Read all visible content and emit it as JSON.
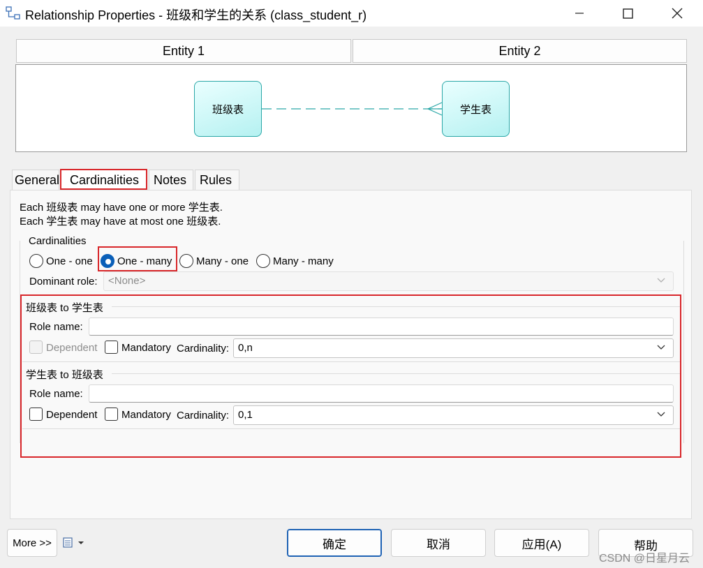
{
  "window": {
    "title": "Relationship Properties - 班级和学生的关系 (class_student_r)",
    "icons": {
      "app": "relationship-app-icon",
      "minimize": "minimize-icon",
      "maximize": "maximize-icon",
      "close": "close-icon"
    }
  },
  "entities": {
    "header1": "Entity 1",
    "header2": "Entity 2",
    "entity1_name": "班级表",
    "entity2_name": "学生表",
    "accent_color": "#2aa7a7"
  },
  "tabs": [
    {
      "label": "General"
    },
    {
      "label": "Cardinalities"
    },
    {
      "label": "Notes"
    },
    {
      "label": "Rules"
    }
  ],
  "description": {
    "line1": "Each 班级表 may have one or more 学生表.",
    "line2": "Each 学生表 may have at most one 班级表."
  },
  "cardinalities": {
    "group_label": "Cardinalities",
    "options": [
      "One - one",
      "One - many",
      "Many - one",
      "Many - many"
    ],
    "selected": "One - many",
    "dominant_label": "Dominant role:",
    "dominant_value": "<None>"
  },
  "role1": {
    "title": "班级表 to 学生表",
    "role_name_label": "Role name:",
    "role_name_value": "",
    "dependent_label": "Dependent",
    "mandatory_label": "Mandatory",
    "cardinality_label": "Cardinality:",
    "cardinality_value": "0,n"
  },
  "role2": {
    "title": "学生表 to 班级表",
    "role_name_label": "Role name:",
    "role_name_value": "",
    "dependent_label": "Dependent",
    "mandatory_label": "Mandatory",
    "cardinality_label": "Cardinality:",
    "cardinality_value": "0,1"
  },
  "footer": {
    "more_label": "More >>",
    "ok_label": "确定",
    "cancel_label": "取消",
    "apply_label": "应用(A)",
    "help_label": "帮助",
    "watermark": "CSDN @日星月云"
  },
  "colors": {
    "highlight": "#d8262a",
    "radio_selected": "#0a5fb8"
  }
}
